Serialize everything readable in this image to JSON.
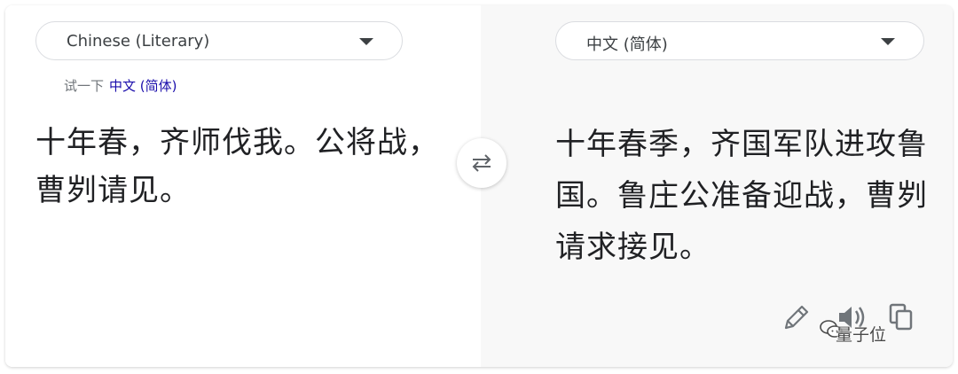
{
  "source": {
    "language": "Chinese (Literary)",
    "suggestion_prefix": "试一下",
    "suggestion_link": "中文 (简体)",
    "text": "十年春，齐师伐我。公将战，曹刿请见。"
  },
  "target": {
    "language": "中文 (简体)",
    "text": "十年春季，齐国军队进攻鲁国。鲁庄公准备迎战，曹刿请求接见。"
  },
  "icons": {
    "swap": "swap-arrows-icon",
    "edit": "pencil-icon",
    "listen": "speaker-icon",
    "copy": "copy-icon"
  },
  "watermark": {
    "text": "量子位"
  },
  "colors": {
    "link": "#1a0dab",
    "text": "#202124",
    "icon": "#70757a",
    "right_pane": "#f8f8f8"
  }
}
